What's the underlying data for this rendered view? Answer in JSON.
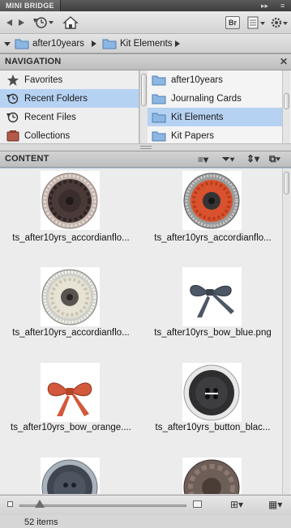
{
  "window": {
    "title": "MINI BRIDGE"
  },
  "path": {
    "crumbs": [
      {
        "label": "after10years"
      },
      {
        "label": "Kit Elements"
      }
    ]
  },
  "toolbar": {
    "br_label": "Br"
  },
  "navigation": {
    "title": "NAVIGATION",
    "left_items": [
      {
        "label": "Favorites",
        "icon": "star-icon",
        "selected": false
      },
      {
        "label": "Recent Folders",
        "icon": "recent-folders-icon",
        "selected": true
      },
      {
        "label": "Recent Files",
        "icon": "recent-files-icon",
        "selected": false
      },
      {
        "label": "Collections",
        "icon": "collections-icon",
        "selected": false
      }
    ],
    "right_items": [
      {
        "label": "after10years",
        "selected": false
      },
      {
        "label": "Journaling Cards",
        "selected": false
      },
      {
        "label": "Kit Elements",
        "selected": true
      },
      {
        "label": "Kit Papers",
        "selected": false
      }
    ]
  },
  "content": {
    "title": "CONTENT",
    "items": [
      {
        "caption": "ts_after10yrs_accordianflo...",
        "art": "flower-brown"
      },
      {
        "caption": "ts_after10yrs_accordianflo...",
        "art": "flower-orange"
      },
      {
        "caption": "ts_after10yrs_accordianflo...",
        "art": "flower-cream"
      },
      {
        "caption": "ts_after10yrs_bow_blue.png",
        "art": "bow-blue"
      },
      {
        "caption": "ts_after10yrs_bow_orange....",
        "art": "bow-orange"
      },
      {
        "caption": "ts_after10yrs_button_blac...",
        "art": "button-black"
      },
      {
        "caption": "",
        "art": "button-blue"
      },
      {
        "caption": "",
        "art": "flower-brown-button"
      }
    ]
  },
  "status": {
    "count_text": "52 items"
  },
  "colors": {
    "selection": "#b6d2f3",
    "folder": "#7aa7d8",
    "accent_border": "#6f9fd3"
  }
}
